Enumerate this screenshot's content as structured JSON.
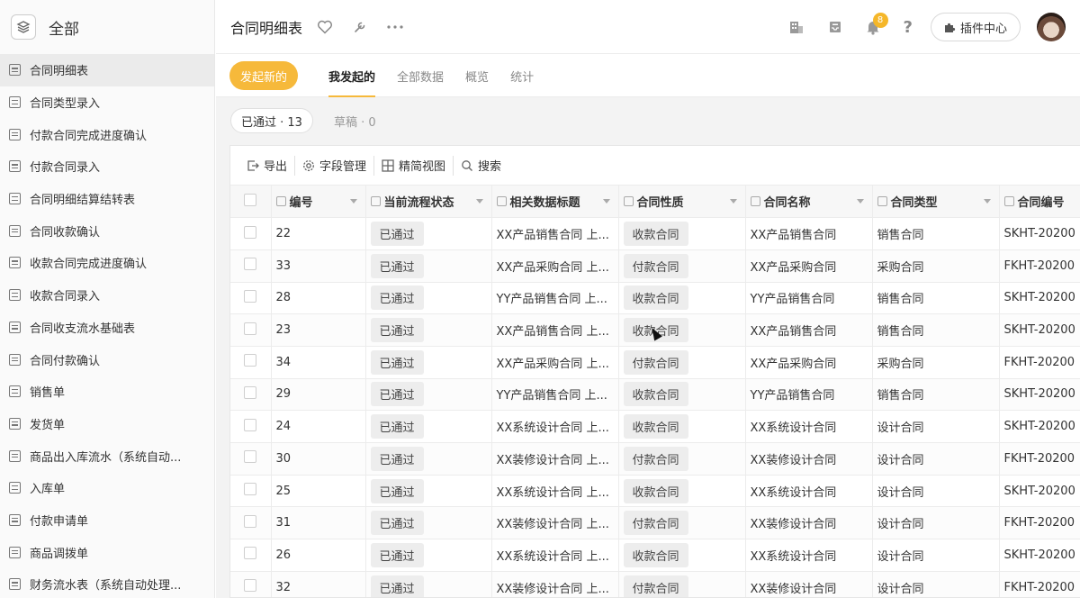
{
  "sidebar": {
    "title": "全部",
    "items": [
      {
        "label": "合同明细表",
        "active": true
      },
      {
        "label": "合同类型录入"
      },
      {
        "label": "付款合同完成进度确认"
      },
      {
        "label": "付款合同录入"
      },
      {
        "label": "合同明细结算结转表"
      },
      {
        "label": "合同收款确认"
      },
      {
        "label": "收款合同完成进度确认"
      },
      {
        "label": "收款合同录入"
      },
      {
        "label": "合同收支流水基础表"
      },
      {
        "label": "合同付款确认"
      },
      {
        "label": "销售单"
      },
      {
        "label": "发货单"
      },
      {
        "label": "商品出入库流水（系统自动..."
      },
      {
        "label": "入库单"
      },
      {
        "label": "付款申请单"
      },
      {
        "label": "商品调拨单"
      },
      {
        "label": "财务流水表（系统自动处理..."
      }
    ]
  },
  "header": {
    "title": "合同明细表",
    "notification_count": "8",
    "help_label": "?",
    "plugin_label": "插件中心"
  },
  "tabs": {
    "new_label": "发起新的",
    "items": [
      "我发起的",
      "全部数据",
      "概览",
      "统计"
    ]
  },
  "filters": {
    "approved": "已通过 · 13",
    "draft": "草稿 · 0"
  },
  "toolbar": {
    "export": "导出",
    "fields": "字段管理",
    "simple_view": "精简视图",
    "search": "搜索"
  },
  "table": {
    "columns": [
      "编号",
      "当前流程状态",
      "相关数据标题",
      "合同性质",
      "合同名称",
      "合同类型",
      "合同编号"
    ],
    "rows": [
      {
        "id": "22",
        "status": "已通过",
        "title": "XX产品销售合同 上...",
        "nature": "收款合同",
        "name": "XX产品销售合同",
        "type": "销售合同",
        "code": "SKHT-20200"
      },
      {
        "id": "33",
        "status": "已通过",
        "title": "XX产品采购合同 上...",
        "nature": "付款合同",
        "name": "XX产品采购合同",
        "type": "采购合同",
        "code": "FKHT-20200"
      },
      {
        "id": "28",
        "status": "已通过",
        "title": "YY产品销售合同 上...",
        "nature": "收款合同",
        "name": "YY产品销售合同",
        "type": "销售合同",
        "code": "SKHT-20200"
      },
      {
        "id": "23",
        "status": "已通过",
        "title": "XX产品销售合同 上...",
        "nature": "收款合同",
        "name": "XX产品销售合同",
        "type": "销售合同",
        "code": "SKHT-20200"
      },
      {
        "id": "34",
        "status": "已通过",
        "title": "XX产品采购合同 上...",
        "nature": "付款合同",
        "name": "XX产品采购合同",
        "type": "采购合同",
        "code": "FKHT-20200"
      },
      {
        "id": "29",
        "status": "已通过",
        "title": "YY产品销售合同 上...",
        "nature": "收款合同",
        "name": "YY产品销售合同",
        "type": "销售合同",
        "code": "SKHT-20200"
      },
      {
        "id": "24",
        "status": "已通过",
        "title": "XX系统设计合同 上...",
        "nature": "收款合同",
        "name": "XX系统设计合同",
        "type": "设计合同",
        "code": "SKHT-20200"
      },
      {
        "id": "30",
        "status": "已通过",
        "title": "XX装修设计合同 上...",
        "nature": "付款合同",
        "name": "XX装修设计合同",
        "type": "设计合同",
        "code": "FKHT-20200"
      },
      {
        "id": "25",
        "status": "已通过",
        "title": "XX系统设计合同 上...",
        "nature": "收款合同",
        "name": "XX系统设计合同",
        "type": "设计合同",
        "code": "SKHT-20200"
      },
      {
        "id": "31",
        "status": "已通过",
        "title": "XX装修设计合同 上...",
        "nature": "付款合同",
        "name": "XX装修设计合同",
        "type": "设计合同",
        "code": "FKHT-20200"
      },
      {
        "id": "26",
        "status": "已通过",
        "title": "XX系统设计合同 上...",
        "nature": "收款合同",
        "name": "XX系统设计合同",
        "type": "设计合同",
        "code": "SKHT-20200"
      },
      {
        "id": "32",
        "status": "已通过",
        "title": "XX装修设计合同 上...",
        "nature": "付款合同",
        "name": "XX装修设计合同",
        "type": "设计合同",
        "code": "FKHT-20200"
      }
    ]
  },
  "colors": {
    "accent": "#f6b93b",
    "badge": "#f5b72a"
  }
}
